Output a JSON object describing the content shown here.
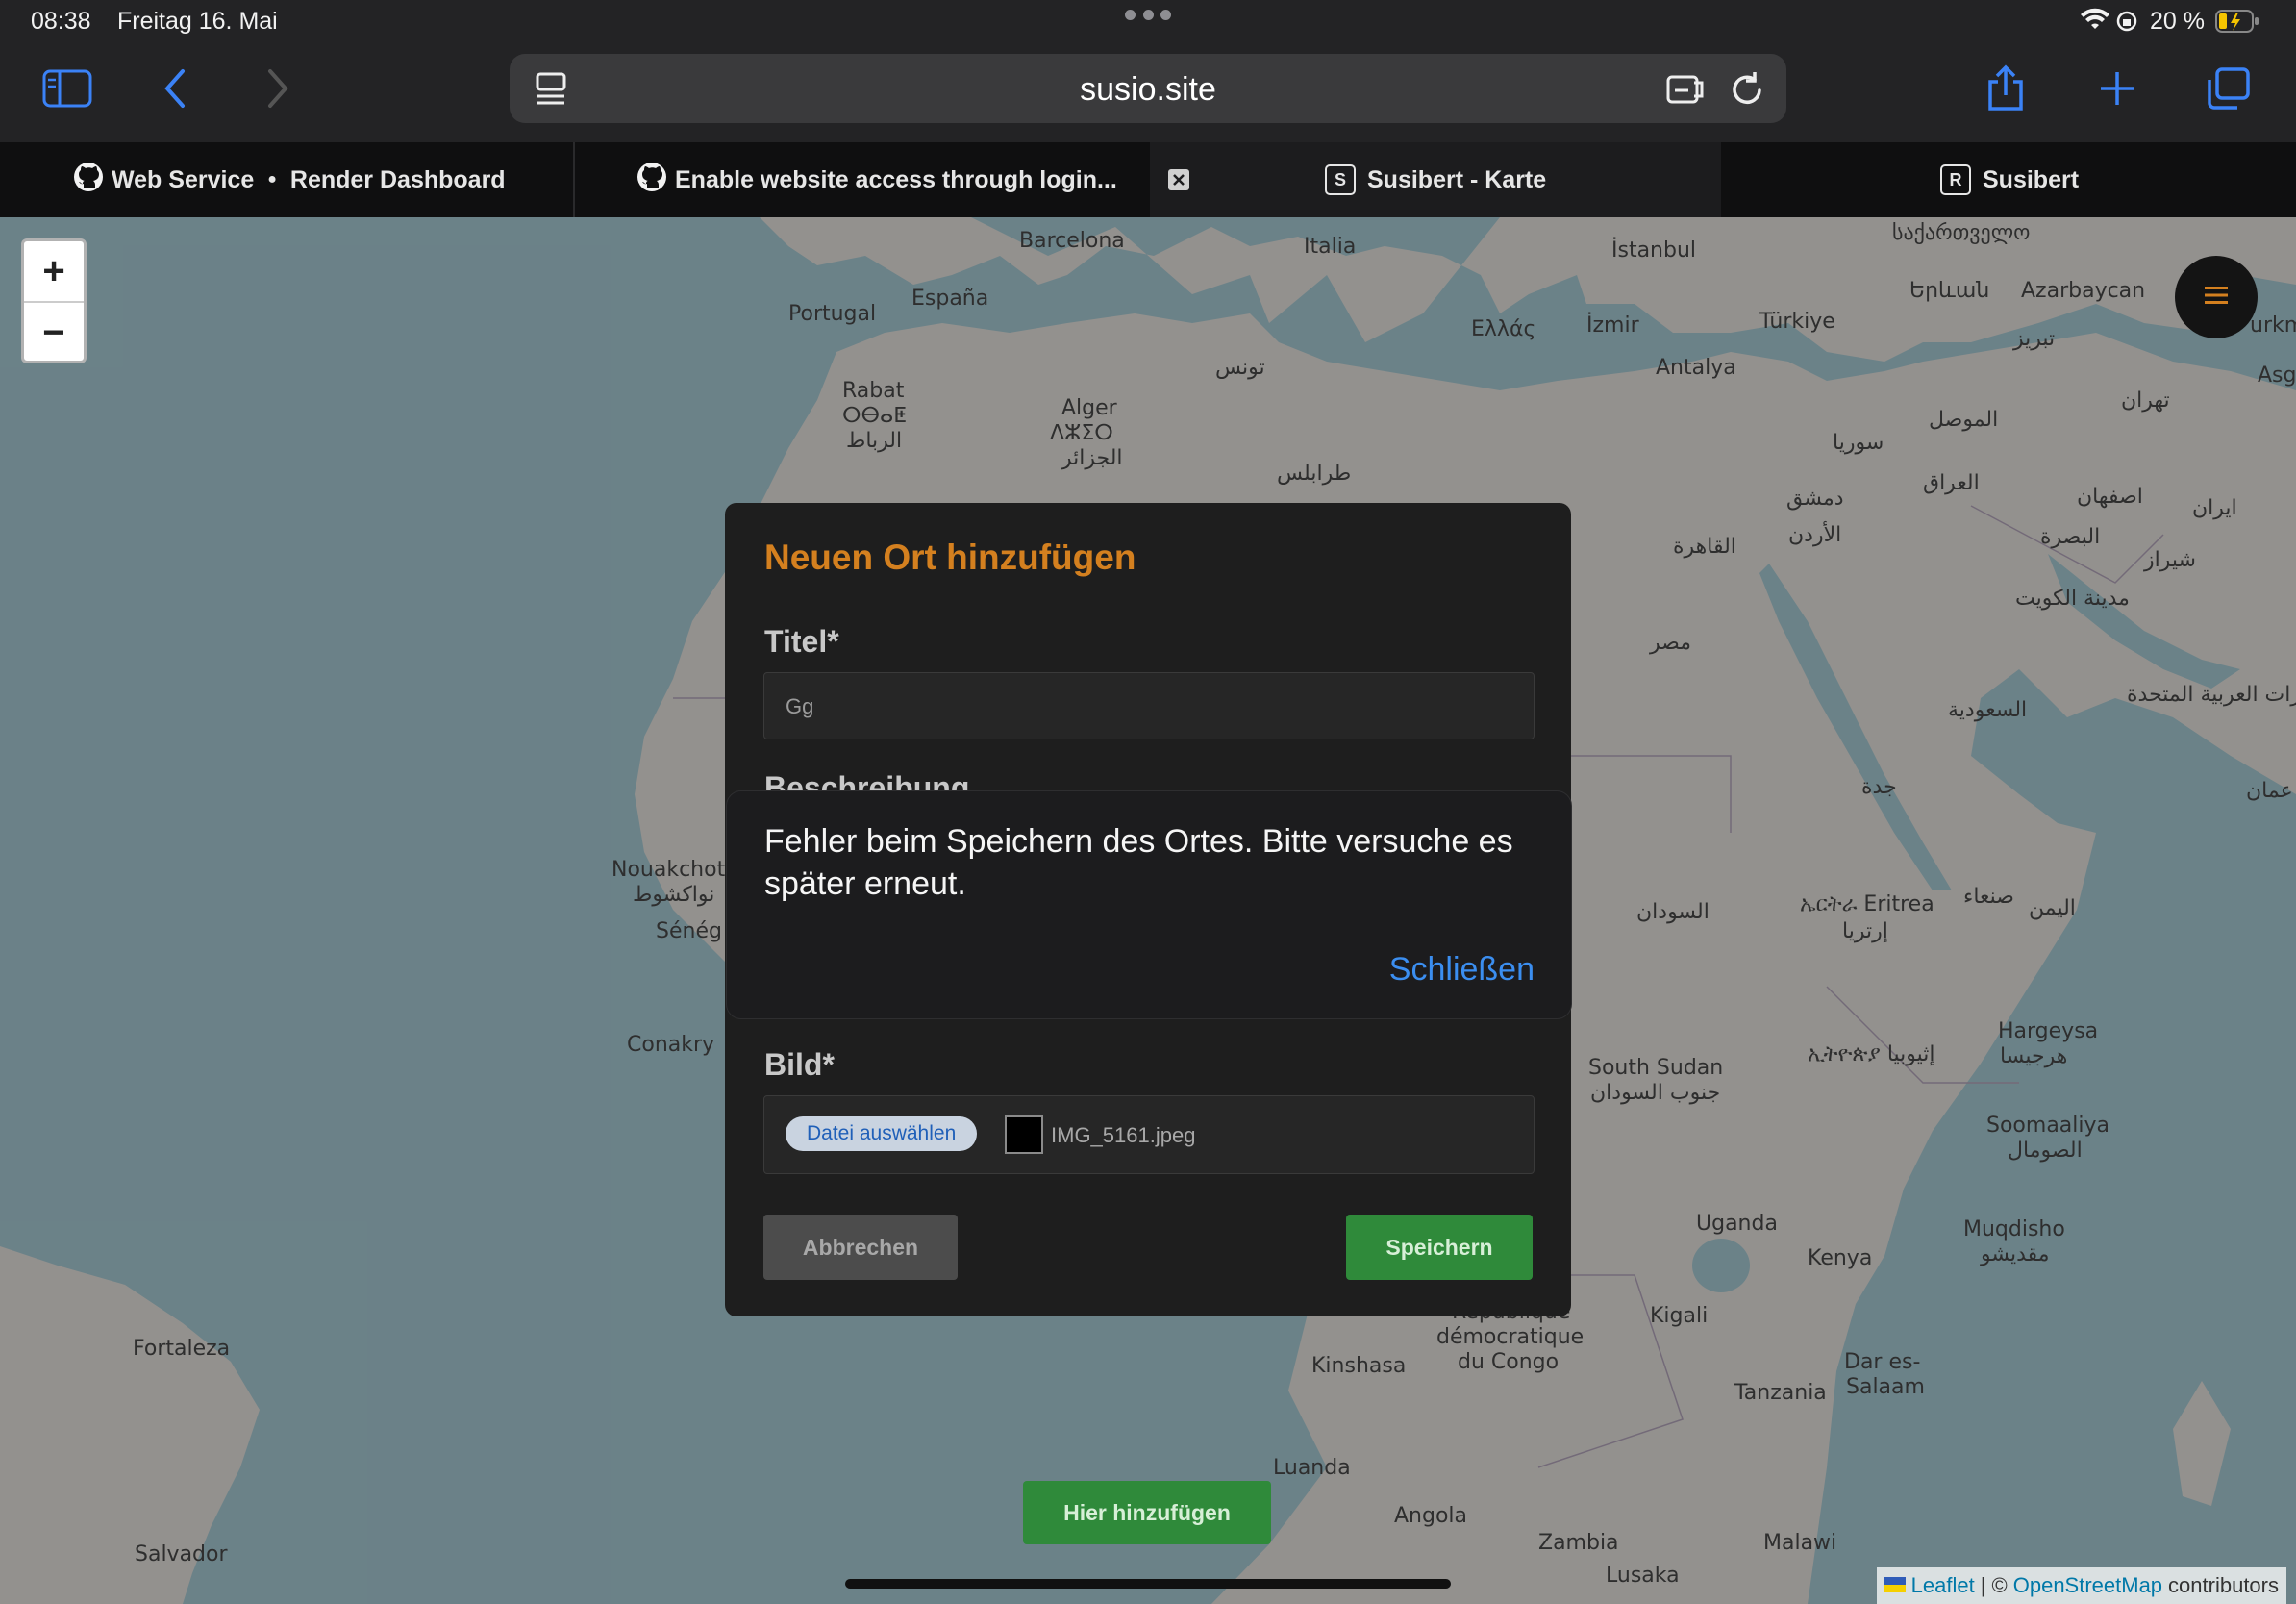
{
  "status_bar": {
    "time": "08:38",
    "date": "Freitag 16. Mai",
    "battery": "20 %",
    "icons": [
      "wifi-icon",
      "lock-rotation-icon",
      "battery-charging-icon"
    ]
  },
  "toolbar": {
    "url": "susio.site",
    "icons": [
      "sidebar-icon",
      "back-icon",
      "forward-icon",
      "page-menu-icon",
      "reader-icon",
      "reload-icon",
      "share-icon",
      "new-tab-icon",
      "tabs-icon"
    ]
  },
  "tabs": [
    {
      "label": "Web Service",
      "label2": "Render Dashboard",
      "icon": "github-icon"
    },
    {
      "label": "Enable website access through login...",
      "icon": "github-icon"
    },
    {
      "label": "Susibert - Karte",
      "icon": "s-badge-icon",
      "badge": "S",
      "active": true
    },
    {
      "label": "Susibert",
      "icon": "r-badge-icon",
      "badge": "R"
    }
  ],
  "map": {
    "zoom_in": "+",
    "zoom_out": "−",
    "here_button": "Hier hinzufügen",
    "attribution": {
      "leaflet": "Leaflet",
      "sep": "| ©",
      "osm": "OpenStreetMap",
      "suffix": "contributors"
    },
    "labels": [
      "Barcelona",
      "Italia",
      "Portugal",
      "España",
      "İstanbul",
      "Ελλάς",
      "İzmir",
      "Türkiye",
      "Antalya",
      "Rabat",
      "ⵔⴱⴰⵟ",
      "الرباط",
      "Alger",
      "ⴷⵣⵉⵔ",
      "الجزائر",
      "تونس",
      "طرابلس",
      "Azarbaycan",
      "Երևան",
      "საქართველო",
      "تبريز",
      "تهران",
      "الموصل",
      "العراق",
      "سوريا",
      "دمشق",
      "الأردن",
      "القاهرة",
      "مصر",
      "اصفهان",
      "ایران",
      "البصرة",
      "شيراز",
      "مدينة الكويت",
      "السعودية",
      "الإمارات العربية المتحدة",
      "جدة",
      "Nouakchott",
      "نواكشوط",
      "Sénég",
      "Conakry",
      "السودان",
      "ኤርትራ Eritrea",
      "إرتريا",
      "صنعاء",
      "اليمن",
      "South Sudan",
      "جنوب السودان",
      "ኢትዮጵያ إثيوبيا",
      "Hargeysa",
      "هرجيسا",
      "Soomaaliya",
      "الصومال",
      "Uganda",
      "Kenya",
      "Muqdisho",
      "مقديشو",
      "Kigali",
      "République",
      "démocratique",
      "du Congo",
      "Kinshasa",
      "Dar es-",
      "Salaam",
      "Tanzania",
      "Luanda",
      "Angola",
      "Zambia",
      "Malawi",
      "Lusaka",
      "Fortaleza",
      "Salvador",
      "Asg",
      "urkm",
      "عمان"
    ]
  },
  "modal": {
    "title": "Neuen Ort hinzufügen",
    "title_label": "Titel*",
    "title_value": "Gg",
    "description_label": "Beschreibung",
    "image_label": "Bild*",
    "file_button": "Datei auswählen",
    "file_name": "IMG_5161.jpeg",
    "cancel": "Abbrechen",
    "save": "Speichern"
  },
  "alert": {
    "message": "Fehler beim Speichern des Ortes. Bitte versuche es später erneut.",
    "close": "Schließen"
  },
  "colors": {
    "accent_orange": "#d4801f",
    "save_green": "#2f8a3a",
    "link_blue": "#3b8ef0",
    "safari_blue": "#3b82f6"
  }
}
